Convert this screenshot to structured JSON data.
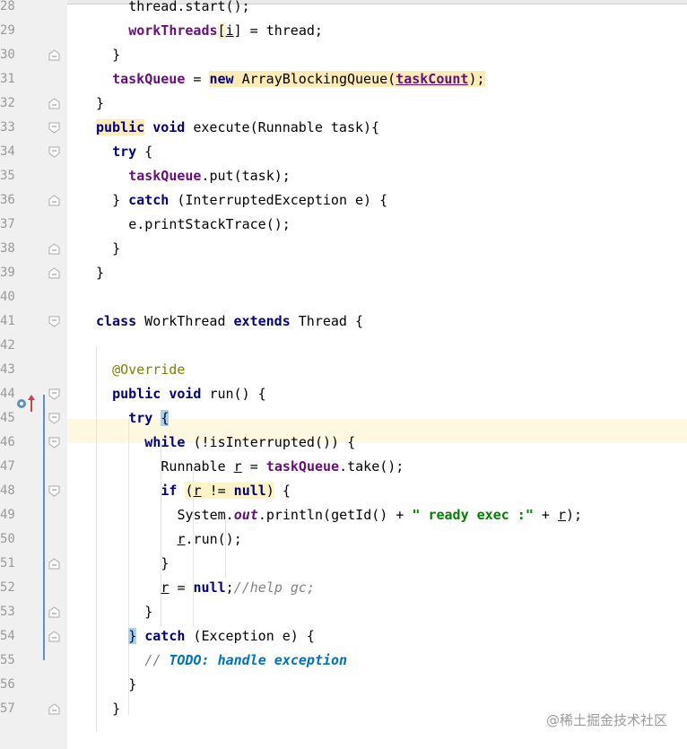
{
  "editor": {
    "line_numbers": [
      "28",
      "29",
      "30",
      "31",
      "32",
      "33",
      "34",
      "35",
      "36",
      "37",
      "38",
      "39",
      "40",
      "41",
      "42",
      "43",
      "44",
      "45",
      "46",
      "47",
      "48",
      "49",
      "50",
      "51",
      "52",
      "53",
      "54",
      "55",
      "56",
      "57"
    ],
    "lines": {
      "l28": {
        "a": "thread.start();"
      },
      "l29": {
        "a": "workThreads",
        "b": "[",
        "c": "i",
        "d": "] = thread;"
      },
      "l30": {
        "a": "}"
      },
      "l31": {
        "a": "taskQueue",
        "b": " = ",
        "c": "new",
        "d": " ArrayBlockingQueue(",
        "e": "taskCount",
        "f": ");"
      },
      "l32": {
        "a": "}"
      },
      "l33": {
        "a": "public",
        "b": " ",
        "c": "void",
        "d": " execute(Runnable task){"
      },
      "l34": {
        "a": "try",
        "b": " {"
      },
      "l35": {
        "a": "taskQueue",
        "b": ".put(task);"
      },
      "l36": {
        "a": "} ",
        "b": "catch",
        "c": " (InterruptedException e) {"
      },
      "l37": {
        "a": "e.printStackTrace();"
      },
      "l38": {
        "a": "}"
      },
      "l39": {
        "a": "}"
      },
      "l41": {
        "a": "class",
        "b": " WorkThread ",
        "c": "extends",
        "d": " Thread {"
      },
      "l43": {
        "a": "@Override"
      },
      "l44": {
        "a": "public",
        "b": " ",
        "c": "void",
        "d": " run() {"
      },
      "l45": {
        "a": "try",
        "b": " ",
        "c": "{"
      },
      "l46": {
        "a": "while",
        "b": " (!isInterrupted()) {"
      },
      "l47": {
        "a": "Runnable ",
        "b": "r",
        "c": " = ",
        "d": "taskQueue",
        "e": ".take();"
      },
      "l48": {
        "a": "if",
        "b": " ",
        "c": "(",
        "d": "r",
        "e": " != ",
        "f": "null",
        "g": ")",
        "h": " {"
      },
      "l49": {
        "a": "System.",
        "b": "out",
        "c": ".println(getId() + ",
        "d": "\" ready exec :\"",
        "e": " + ",
        "f": "r",
        "g": ");"
      },
      "l50": {
        "a": "r",
        "b": ".run();"
      },
      "l51": {
        "a": "}"
      },
      "l52": {
        "a": "r",
        "b": " = ",
        "c": "null",
        "d": ";",
        "e": "//help gc;"
      },
      "l53": {
        "a": "}"
      },
      "l54": {
        "a": "}",
        "b": " ",
        "c": "catch",
        "d": " (Exception e) {"
      },
      "l55": {
        "a": "// ",
        "b": "TODO: handle exception"
      },
      "l56": {
        "a": "}"
      },
      "l57": {
        "a": "}"
      }
    }
  },
  "watermark": "@稀土掘金技术社区",
  "colors": {
    "keyword": "#000080",
    "field": "#660e7a",
    "annotation": "#808000",
    "string": "#008000",
    "comment": "#808080",
    "todo": "#0073bf",
    "current_line": "#fdf8df"
  }
}
